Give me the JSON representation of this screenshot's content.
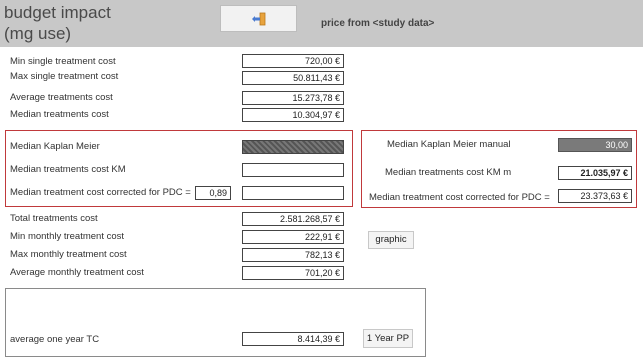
{
  "header": {
    "title": "budget impact\n(mg use)",
    "price_from": "price from <study data>"
  },
  "rows_top": [
    {
      "label": "Min single treatment cost",
      "value": "720,00 €"
    },
    {
      "label": "Max single treatment cost",
      "value": "50.811,43 €"
    },
    {
      "label": "Average treatments cost",
      "value": "15.273,78 €"
    },
    {
      "label": "Median treatments cost",
      "value": "10.304,97 €"
    }
  ],
  "km_box": {
    "median_km_label": "Median Kaplan Meier",
    "median_cost_km_label": "Median treatments cost KM",
    "pdc_label": "Median treatment cost corrected for PDC =",
    "pdc_value": "0,89"
  },
  "km_manual_box": {
    "median_km_manual_label": "Median Kaplan Meier manual",
    "median_km_manual_value": "30,00",
    "median_cost_km_m_label": "Median treatments cost KM m",
    "median_cost_km_m_value": "21.035,97 €",
    "pdc_label": "Median treatment cost corrected for PDC =",
    "pdc_value": "23.373,63 €"
  },
  "rows_bottom": [
    {
      "label": "Total treatments cost",
      "value": "2.581.268,57 €"
    },
    {
      "label": "Min monthly treatment cost",
      "value": "222,91 €"
    },
    {
      "label": "Max monthly treatment cost",
      "value": "782,13 €"
    },
    {
      "label": "Average monthly treatment cost",
      "value": "701,20 €"
    }
  ],
  "graphic_button": "graphic",
  "one_year": {
    "label": "average one year TC",
    "value": "8.414,39 €",
    "button": "1 Year PP"
  },
  "colors": {
    "header_bg": "#c8c8c8",
    "frame_red": "#c0393b",
    "exit_icon": "#e8a33d"
  },
  "icons": {
    "exit": "exit-door-arrow-icon"
  }
}
